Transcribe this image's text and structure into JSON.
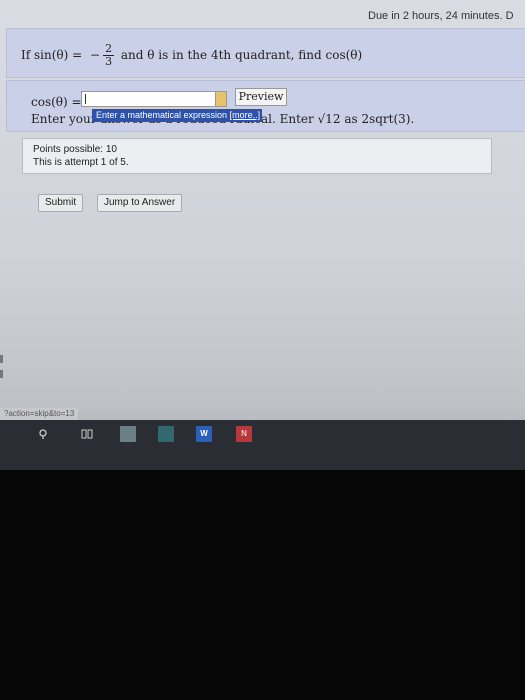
{
  "header": {
    "due_text": "Due in 2 hours, 24 minutes. D"
  },
  "question": {
    "prefix": "If sin(θ) = ",
    "neg": "−",
    "numerator": "2",
    "denominator": "3",
    "suffix": " and θ is in the 4th quadrant, find cos(θ)"
  },
  "answer": {
    "label": "cos(θ) =",
    "input_value": "",
    "preview_label": "Preview",
    "hint": "Enter your answer as a reduced radical. Enter √12 as 2sqrt(3).",
    "tooltip": "Enter a mathematical expression",
    "tooltip_more": "[more..]"
  },
  "info": {
    "points": "Points possible: 10",
    "attempt": "This is attempt 1 of 5."
  },
  "buttons": {
    "submit": "Submit",
    "jump": "Jump to Answer"
  },
  "status_url": "?action=skip&to=13",
  "taskbar": {
    "search_icon": "search-icon",
    "taskview_icon": "task-view-icon",
    "word_label": "W",
    "app_label": "N"
  }
}
